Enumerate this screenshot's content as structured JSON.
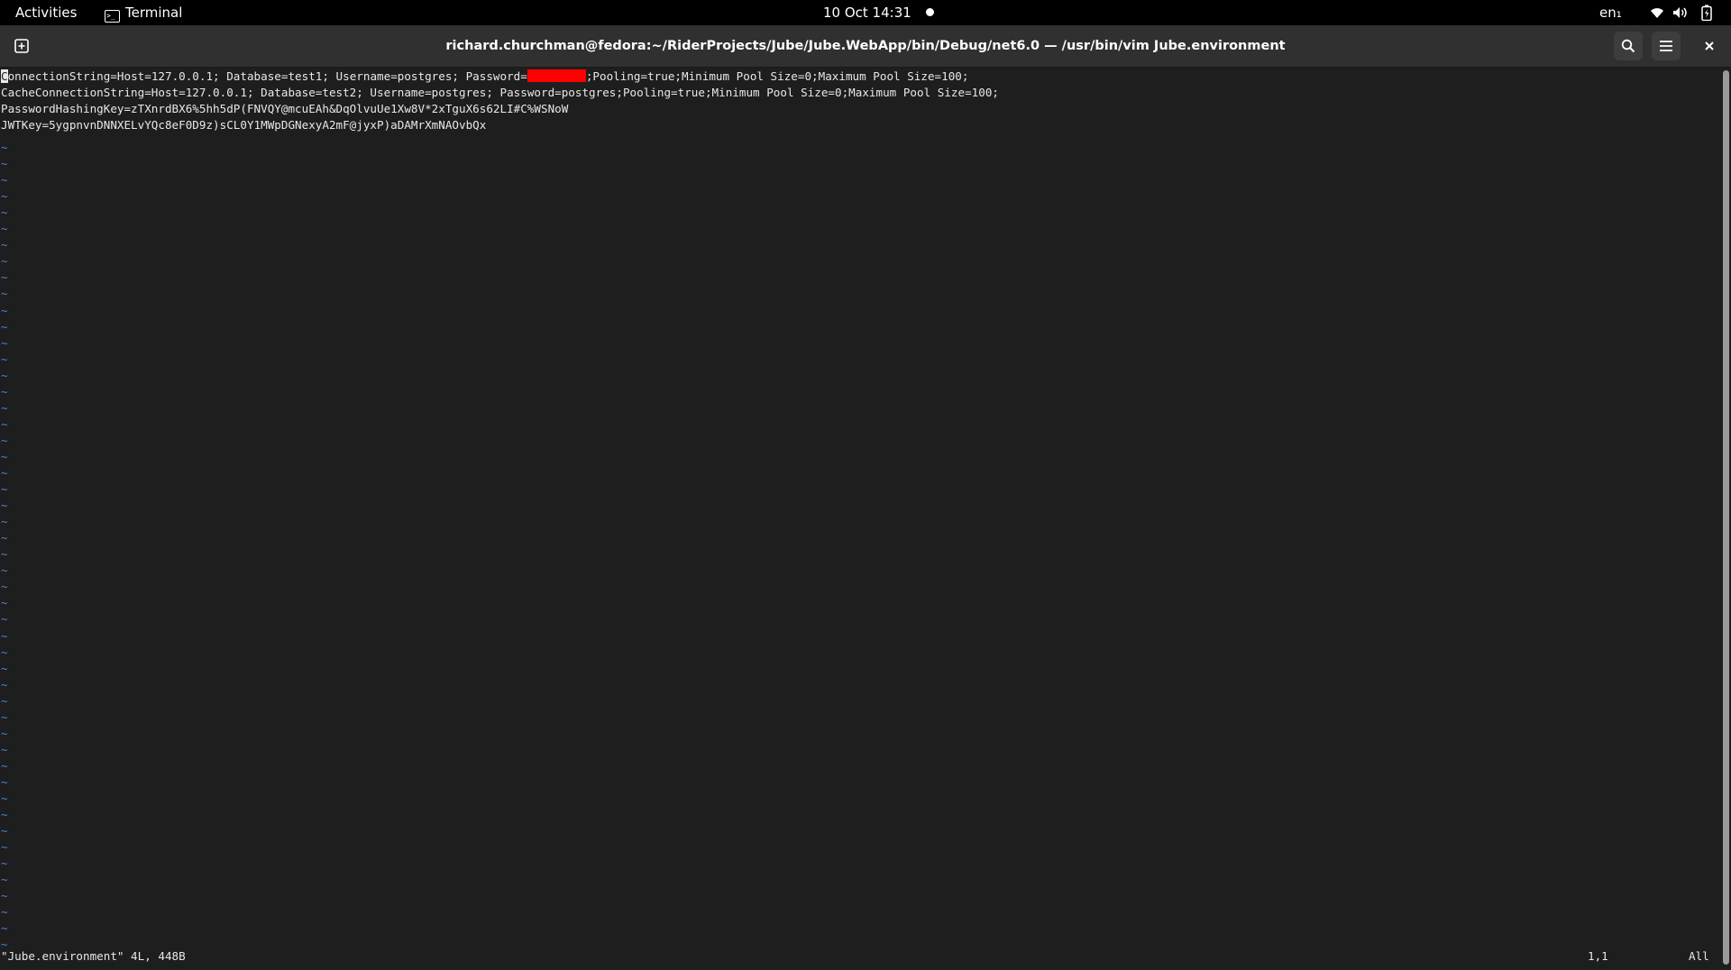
{
  "topbar": {
    "activities": "Activities",
    "app_name": "Terminal",
    "clock": "10 Oct  14:31",
    "language": "en₁"
  },
  "window": {
    "title": "richard.churchman@fedora:~/RiderProjects/Jube/Jube.WebApp/bin/Debug/net6.0 — /usr/bin/vim Jube.environment"
  },
  "editor": {
    "lines": [
      {
        "cursor_char": "C",
        "before": "onnectionString=Host=127.0.0.1; Database=test1; Username=postgres; Password=",
        "after": ";Pooling=true;Minimum Pool Size=0;Maximum Pool Size=100;"
      },
      {
        "text": "CacheConnectionString=Host=127.0.0.1; Database=test2; Username=postgres; Password=postgres;Pooling=true;Minimum Pool Size=0;Maximum Pool Size=100;"
      },
      {
        "text": "PasswordHashingKey=zTXnrdBX6%5hh5dP(FNVQY@mcuEAh&DqOlvuUe1Xw8V*2xTguX6s62LI#C%WSNoW"
      },
      {
        "text": "JWTKey=5ygpnvnDNNXELvYQc8eF0D9z)sCL0Y1MWpDGNexyA2mF@jyxP)aDAMrXmNAOvbQx"
      }
    ],
    "tilde": "~",
    "tilde_count": 50,
    "status_message": "\"Jube.environment\" 4L, 448B",
    "cursor_position": "1,1",
    "scroll_percent": "All"
  },
  "colors": {
    "background": "#1e1e1e",
    "text": "#e8e8e8",
    "tilde": "#4a86c7",
    "redaction": "#ff0000"
  }
}
